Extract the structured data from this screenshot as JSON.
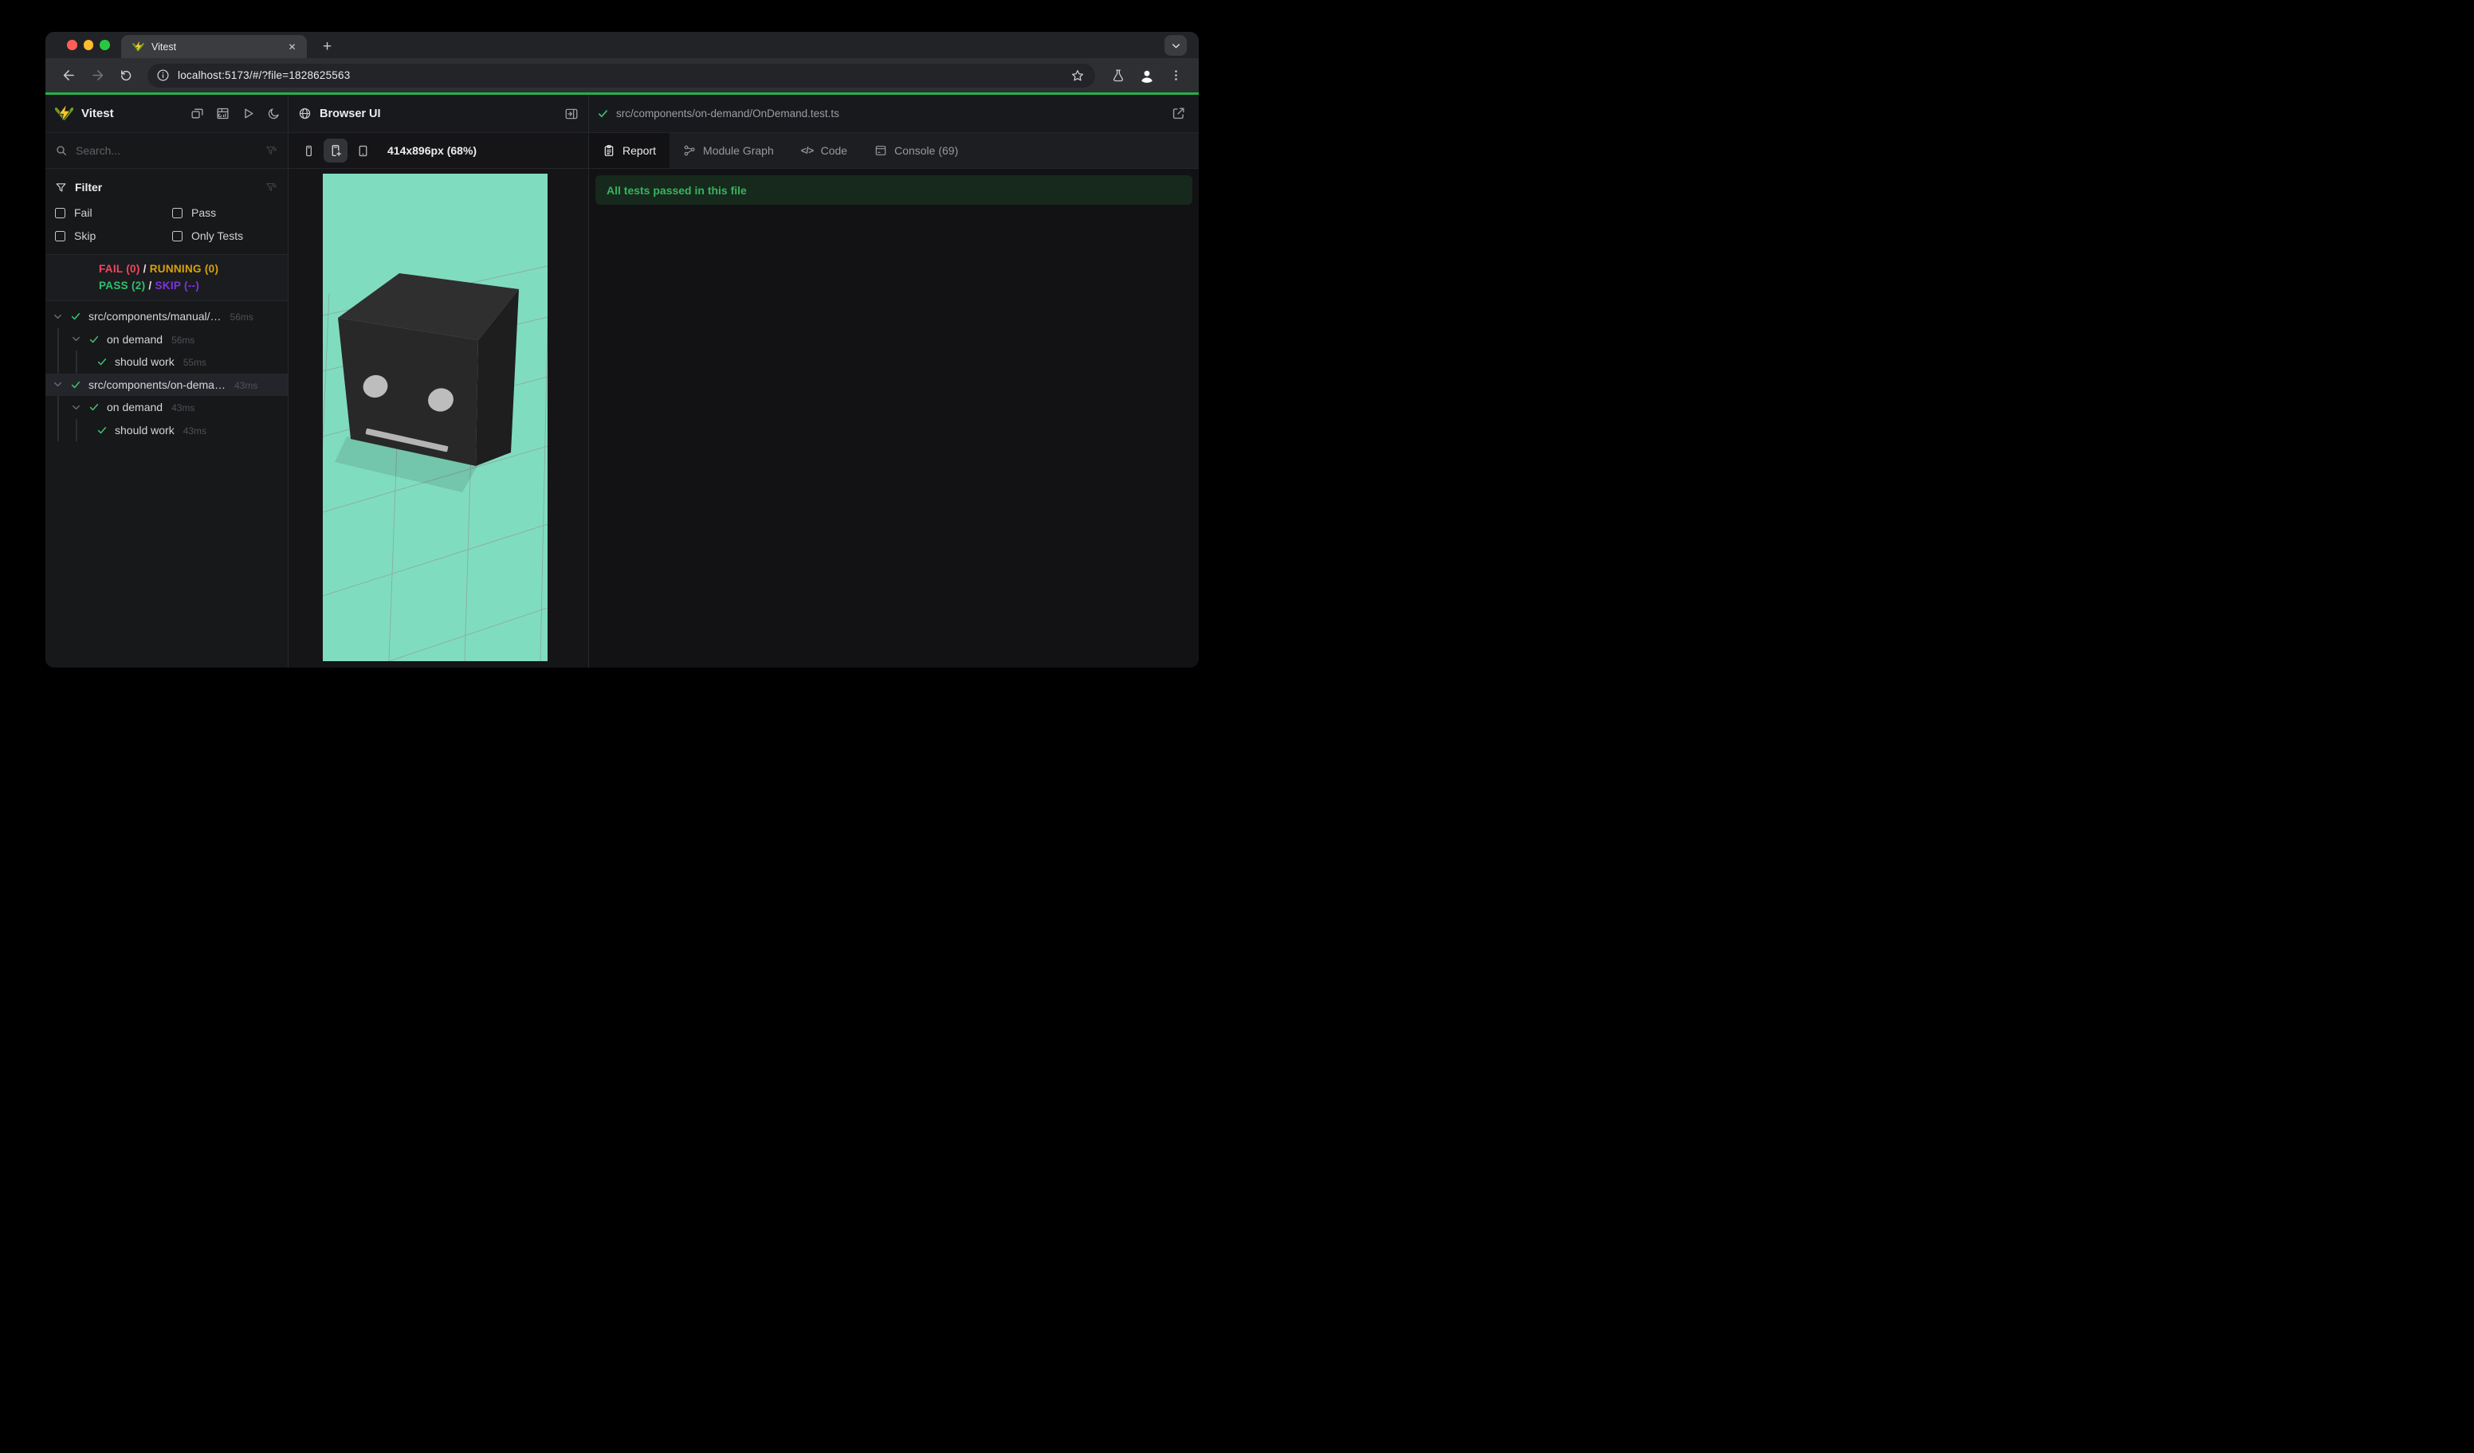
{
  "browser": {
    "tab_title": "Vitest",
    "url": "localhost:5173/#/?file=1828625563",
    "icons": {
      "close": "✕",
      "new_tab": "+",
      "code": "</>"
    }
  },
  "sidebar": {
    "title": "Vitest",
    "search_placeholder": "Search...",
    "filter": {
      "title": "Filter",
      "options": [
        {
          "label": "Fail",
          "checked": false
        },
        {
          "label": "Pass",
          "checked": false
        },
        {
          "label": "Skip",
          "checked": false
        },
        {
          "label": "Only Tests",
          "checked": false
        }
      ]
    },
    "stats": {
      "fail": "FAIL (0)",
      "running": "RUNNING (0)",
      "pass": "PASS (2)",
      "skip": "SKIP (--)",
      "separator": "/"
    },
    "tree": [
      {
        "label": "src/components/manual/…",
        "time": "56ms",
        "level": 0,
        "expandable": true,
        "selected": false
      },
      {
        "label": "on demand",
        "time": "56ms",
        "level": 1,
        "expandable": true,
        "selected": false
      },
      {
        "label": "should work",
        "time": "55ms",
        "level": 2,
        "expandable": false,
        "selected": false
      },
      {
        "label": "src/components/on-dema…",
        "time": "43ms",
        "level": 0,
        "expandable": true,
        "selected": true
      },
      {
        "label": "on demand",
        "time": "43ms",
        "level": 1,
        "expandable": true,
        "selected": false
      },
      {
        "label": "should work",
        "time": "43ms",
        "level": 2,
        "expandable": false,
        "selected": false
      }
    ]
  },
  "browser_panel": {
    "title": "Browser UI",
    "viewport_label": "414x896px (68%)"
  },
  "report_panel": {
    "file_path": "src/components/on-demand/OnDemand.test.ts",
    "tabs": [
      {
        "label": "Report",
        "active": true
      },
      {
        "label": "Module Graph",
        "active": false
      },
      {
        "label": "Code",
        "active": false
      },
      {
        "label": "Console (69)",
        "active": false
      }
    ],
    "banner": "All tests passed in this file"
  },
  "colors": {
    "accent": "#27b04c",
    "fail": "#f3475c",
    "running": "#d9a30a",
    "pass": "#30c06e",
    "skip": "#7e33e0",
    "check": "#3fc26f",
    "mint": "#80dcbf",
    "banner_bg": "#16291c",
    "banner_text": "#36b45f"
  }
}
